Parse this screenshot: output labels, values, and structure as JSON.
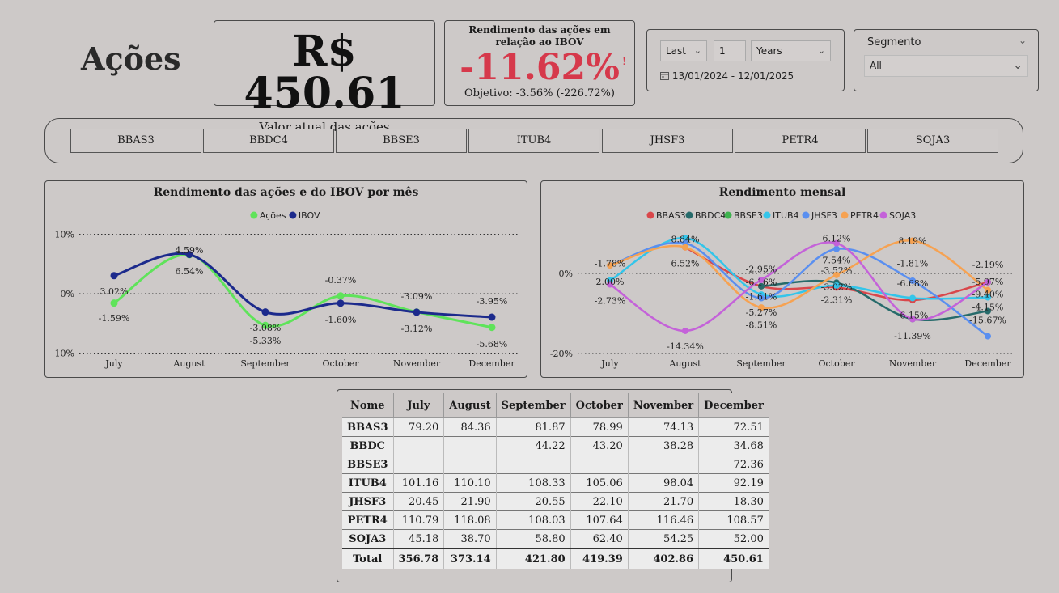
{
  "page": {
    "title": "Ações"
  },
  "kpi_value": {
    "value": "R$ 450.61",
    "label": "Valor atual das ações"
  },
  "kpi_perf": {
    "header": "Rendimento das ações em relação ao IBOV",
    "value": "-11.62%",
    "warning": "!",
    "goal": "Objetivo: -3.56% (-226.72%)"
  },
  "date_filter": {
    "mode": "Last",
    "count": "1",
    "unit": "Years",
    "range": "13/01/2024 - 12/01/2025"
  },
  "segment_filter": {
    "label": "Segmento",
    "value": "All"
  },
  "tickers": [
    "BBAS3",
    "BBDC4",
    "BBSE3",
    "ITUB4",
    "JHSF3",
    "PETR4",
    "SOJA3"
  ],
  "chart_data": [
    {
      "type": "line",
      "title": "Rendimento das ações e do IBOV por mês",
      "categories": [
        "July",
        "August",
        "September",
        "October",
        "November",
        "December"
      ],
      "yticks": [
        "10%",
        "0%",
        "-10%"
      ],
      "ylim": [
        -10,
        10
      ],
      "legend_position": "top-center",
      "series": [
        {
          "name": "Ações",
          "color": "#5fe35a",
          "values": [
            -1.59,
            6.54,
            -5.33,
            -0.37,
            -3.09,
            -5.68
          ],
          "labels": [
            "-1.59%",
            "6.54%",
            "-5.33%",
            "-0.37%",
            "-3.09%",
            "-5.68%"
          ]
        },
        {
          "name": "IBOV",
          "color": "#1c2a8c",
          "values": [
            3.02,
            6.59,
            -3.08,
            -1.6,
            -3.12,
            -3.95
          ],
          "labels": [
            "3.02%",
            "4.59%",
            "-3.08%",
            "-1.60%",
            "-3.12%",
            "-3.95%"
          ]
        }
      ]
    },
    {
      "type": "line",
      "title": "Rendimento mensal",
      "categories": [
        "July",
        "August",
        "September",
        "October",
        "November",
        "December"
      ],
      "yticks": [
        "0%",
        "-20%"
      ],
      "ylim": [
        -20,
        10
      ],
      "legend_position": "top-center",
      "series": [
        {
          "name": "BBAS3",
          "color": "#d9474b",
          "values": [
            null,
            6.52,
            -3.2,
            -3.52,
            -6.68,
            -2.19
          ]
        },
        {
          "name": "BBDC4",
          "color": "#276b6b",
          "values": [
            null,
            null,
            -3.2,
            -2.31,
            -11.39,
            -9.4
          ]
        },
        {
          "name": "BBSE3",
          "color": "#3fb24f",
          "values": [
            null,
            null,
            null,
            null,
            null,
            -2.19
          ]
        },
        {
          "name": "ITUB4",
          "color": "#33c5ea",
          "values": [
            -1.78,
            8.84,
            -5.27,
            -3.02,
            -6.15,
            -5.97
          ]
        },
        {
          "name": "JHSF3",
          "color": "#5a8ff0",
          "values": [
            2.0,
            7.54,
            -6.16,
            6.12,
            -1.81,
            -15.67
          ]
        },
        {
          "name": "PETR4",
          "color": "#f6a252",
          "values": [
            2.0,
            6.52,
            -8.51,
            -0.37,
            8.19,
            -4.15
          ]
        },
        {
          "name": "SOJA3",
          "color": "#c462d9",
          "values": [
            -2.73,
            -14.34,
            -1.61,
            7.54,
            -11.39,
            -2.19
          ]
        }
      ],
      "data_labels": [
        {
          "text": "-1.78%",
          "x": "July",
          "y": 2.5
        },
        {
          "text": "2.00%",
          "x": "July",
          "y": -2.0
        },
        {
          "text": "-2.73%",
          "x": "July",
          "y": -6.8
        },
        {
          "text": "8.84%",
          "x": "August",
          "y": 8.6
        },
        {
          "text": "6.52%",
          "x": "August",
          "y": 2.5
        },
        {
          "text": "-14.34%",
          "x": "August",
          "y": -18.2
        },
        {
          "text": "-2.95%",
          "x": "September",
          "y": 1.1
        },
        {
          "text": "-6.16%",
          "x": "September",
          "y": -2.1
        },
        {
          "text": "-1.61%",
          "x": "September",
          "y": -5.8
        },
        {
          "text": "-5.27%",
          "x": "September",
          "y": -9.7
        },
        {
          "text": "-8.51%",
          "x": "September",
          "y": -12.8
        },
        {
          "text": "6.12%",
          "x": "October",
          "y": 8.8
        },
        {
          "text": "7.54%",
          "x": "October",
          "y": 3.3
        },
        {
          "text": "-3.52%",
          "x": "October",
          "y": 0.8
        },
        {
          "text": "-3.02%",
          "x": "October",
          "y": -3.3
        },
        {
          "text": "-2.31%",
          "x": "October",
          "y": -6.6
        },
        {
          "text": "8.19%",
          "x": "November",
          "y": 8.2
        },
        {
          "text": "-1.81%",
          "x": "November",
          "y": 2.5
        },
        {
          "text": "-6.68%",
          "x": "November",
          "y": -2.4
        },
        {
          "text": "-6.15%",
          "x": "November",
          "y": -10.4
        },
        {
          "text": "-11.39%",
          "x": "November",
          "y": -15.6
        },
        {
          "text": "-2.19%",
          "x": "December",
          "y": 2.2
        },
        {
          "text": "-5.97%",
          "x": "December",
          "y": -2.0
        },
        {
          "text": "-9.40%",
          "x": "December",
          "y": -5.2
        },
        {
          "text": "-4.15%",
          "x": "December",
          "y": -8.4
        },
        {
          "text": "-15.67%",
          "x": "December",
          "y": -11.6
        }
      ]
    }
  ],
  "table": {
    "columns": [
      "Nome",
      "July",
      "August",
      "September",
      "October",
      "November",
      "December"
    ],
    "rows": [
      [
        "BBAS3",
        "79.20",
        "84.36",
        "81.87",
        "78.99",
        "74.13",
        "72.51"
      ],
      [
        "BBDC",
        "",
        "",
        "44.22",
        "43.20",
        "38.28",
        "34.68"
      ],
      [
        "BBSE3",
        "",
        "",
        "",
        "",
        "",
        "72.36"
      ],
      [
        "ITUB4",
        "101.16",
        "110.10",
        "108.33",
        "105.06",
        "98.04",
        "92.19"
      ],
      [
        "JHSF3",
        "20.45",
        "21.90",
        "20.55",
        "22.10",
        "21.70",
        "18.30"
      ],
      [
        "PETR4",
        "110.79",
        "118.08",
        "108.03",
        "107.64",
        "116.46",
        "108.57"
      ],
      [
        "SOJA3",
        "45.18",
        "38.70",
        "58.80",
        "62.40",
        "54.25",
        "52.00"
      ]
    ],
    "total": [
      "Total",
      "356.78",
      "373.14",
      "421.80",
      "419.39",
      "402.86",
      "450.61"
    ]
  }
}
